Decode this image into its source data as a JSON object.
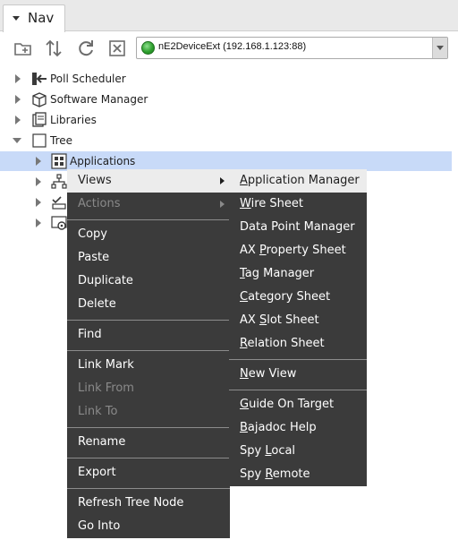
{
  "nav": {
    "tab_label": "Nav",
    "device": {
      "label": "nE2DeviceExt (192.168.1.123:88)",
      "status_color": "#2ea02e"
    }
  },
  "toolbar": {
    "icons": [
      "new-folder-icon",
      "sort-icon",
      "refresh-icon",
      "close-icon"
    ]
  },
  "tree": [
    {
      "label": "Poll Scheduler",
      "icon": "poll-scheduler-icon",
      "state": "collapsed"
    },
    {
      "label": "Software Manager",
      "icon": "software-manager-icon",
      "state": "collapsed"
    },
    {
      "label": "Libraries",
      "icon": "libraries-icon",
      "state": "collapsed"
    },
    {
      "label": "Tree",
      "icon": "tree-icon",
      "state": "expanded"
    },
    {
      "label": "Applications",
      "icon": "applications-icon",
      "state": "collapsed",
      "selected": true
    },
    {
      "label": "",
      "icon": "network-icon",
      "state": "collapsed"
    },
    {
      "label": "",
      "icon": "checklist-icon",
      "state": "collapsed"
    },
    {
      "label": "",
      "icon": "settings-icon",
      "state": "collapsed"
    }
  ],
  "context_menu": {
    "items": [
      {
        "label": "Views",
        "submenu": true,
        "highlighted": true
      },
      {
        "label": "Actions",
        "submenu": true,
        "disabled": true
      },
      {
        "label": "Copy"
      },
      {
        "label": "Paste"
      },
      {
        "label": "Duplicate"
      },
      {
        "label": "Delete"
      },
      {
        "label": "Find"
      },
      {
        "label": "Link Mark"
      },
      {
        "label": "Link From",
        "disabled": true
      },
      {
        "label": "Link To",
        "disabled": true
      },
      {
        "label": "Rename"
      },
      {
        "label": "Export"
      },
      {
        "label": "Refresh Tree Node"
      },
      {
        "label": "Go Into"
      }
    ]
  },
  "views_submenu": {
    "items": [
      {
        "label": "Application Manager",
        "mnemonic": "A",
        "rest": "pplication Manager",
        "highlighted": true
      },
      {
        "label": "Wire Sheet",
        "mnemonic": "W",
        "rest": "ire Sheet"
      },
      {
        "label": "Data Point Manager",
        "mnemonic": "",
        "rest": "Data Point Manager"
      },
      {
        "label": "AX Property Sheet",
        "prefix": "AX ",
        "mnemonic": "P",
        "rest": "roperty Sheet"
      },
      {
        "label": "Tag Manager",
        "mnemonic": "T",
        "rest": "ag Manager"
      },
      {
        "label": "Category Sheet",
        "mnemonic": "C",
        "rest": "ategory Sheet"
      },
      {
        "label": "AX Slot Sheet",
        "prefix": "AX ",
        "mnemonic": "S",
        "rest": "lot Sheet"
      },
      {
        "label": "Relation Sheet",
        "mnemonic": "R",
        "rest": "elation Sheet"
      },
      {
        "label": "New View",
        "mnemonic": "N",
        "rest": "ew View"
      },
      {
        "label": "Guide On Target",
        "mnemonic": "G",
        "rest": "uide On Target"
      },
      {
        "label": "Bajadoc Help",
        "mnemonic": "B",
        "rest": "ajadoc Help"
      },
      {
        "label": "Spy Local",
        "prefix": "Spy ",
        "mnemonic": "L",
        "rest": "ocal"
      },
      {
        "label": "Spy Remote",
        "prefix": "Spy ",
        "mnemonic": "R",
        "rest": "emote"
      }
    ]
  }
}
